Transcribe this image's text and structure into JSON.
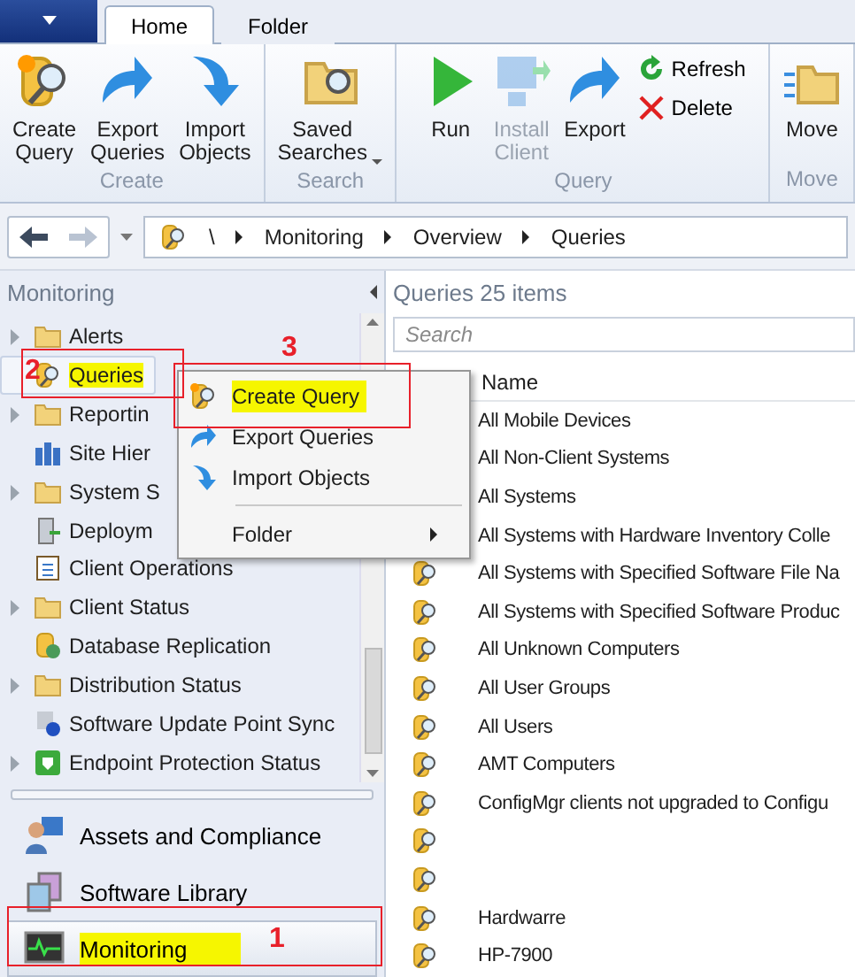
{
  "ribbon": {
    "app_button": {
      "selected": false
    },
    "tabs": [
      {
        "label": "Home",
        "selected": true
      },
      {
        "label": "Folder",
        "selected": false
      }
    ],
    "groups": [
      {
        "label": "Create",
        "buttons": [
          {
            "label": "Create\nQuery",
            "disabled": false
          },
          {
            "label": "Export\nQueries",
            "disabled": false
          },
          {
            "label": "Import\nObjects",
            "disabled": false
          }
        ]
      },
      {
        "label": "Search",
        "buttons": [
          {
            "label": "Saved\nSearches",
            "disabled": false,
            "dropdown": true
          }
        ]
      },
      {
        "label": "Query",
        "buttons": [
          {
            "label": "Run",
            "disabled": false
          },
          {
            "label": "Install\nClient",
            "disabled": true
          },
          {
            "label": "Export",
            "disabled": false
          }
        ],
        "small_buttons": [
          {
            "label": "Refresh"
          },
          {
            "label": "Delete"
          }
        ]
      },
      {
        "label": "Move",
        "buttons": [
          {
            "label": "Move",
            "disabled": false
          }
        ]
      }
    ]
  },
  "nav": {
    "back_disabled": false,
    "forward_disabled": true,
    "breadcrumb": [
      "\\",
      "Monitoring",
      "Overview",
      "Queries"
    ]
  },
  "left_pane": {
    "title": "Monitoring",
    "tree": [
      {
        "label": "Alerts",
        "expandable": true,
        "selected": false,
        "highlighted": false
      },
      {
        "label": "Queries",
        "expandable": false,
        "selected": true,
        "highlighted": true
      },
      {
        "label": "Reportin",
        "expandable": true,
        "selected": false,
        "highlighted": false
      },
      {
        "label": "Site Hier",
        "expandable": false,
        "selected": false,
        "highlighted": false
      },
      {
        "label": "System S",
        "expandable": true,
        "selected": false,
        "highlighted": false
      },
      {
        "label": "Deploym",
        "expandable": false,
        "selected": false,
        "highlighted": false
      },
      {
        "label": "Client Operations",
        "expandable": false,
        "selected": false,
        "highlighted": false
      },
      {
        "label": "Client Status",
        "expandable": true,
        "selected": false,
        "highlighted": false
      },
      {
        "label": "Database Replication",
        "expandable": false,
        "selected": false,
        "highlighted": false
      },
      {
        "label": "Distribution Status",
        "expandable": true,
        "selected": false,
        "highlighted": false
      },
      {
        "label": "Software Update Point Sync",
        "expandable": false,
        "selected": false,
        "highlighted": false
      },
      {
        "label": "Endpoint Protection Status",
        "expandable": true,
        "selected": false,
        "highlighted": false
      }
    ],
    "workspaces": [
      {
        "label": "Assets and Compliance",
        "selected": false,
        "highlighted": false
      },
      {
        "label": "Software Library",
        "selected": false,
        "highlighted": false
      },
      {
        "label": "Monitoring",
        "selected": true,
        "highlighted": true
      }
    ]
  },
  "right_pane": {
    "title": "Queries 25 items",
    "search": {
      "placeholder": "Search"
    },
    "columns": [
      "Name"
    ],
    "rows": [
      {
        "name": "All Mobile Devices"
      },
      {
        "name": "All Non-Client Systems"
      },
      {
        "name": "All Systems"
      },
      {
        "name": "All Systems with Hardware Inventory Colle"
      },
      {
        "name": "All Systems with Specified Software File Na"
      },
      {
        "name": "All Systems with Specified Software Produc"
      },
      {
        "name": "All Unknown Computers"
      },
      {
        "name": "All User Groups"
      },
      {
        "name": "All Users"
      },
      {
        "name": "AMT Computers"
      },
      {
        "name": "ConfigMgr clients not upgraded to Configu"
      },
      {},
      {},
      {
        "name": "Hardwarre"
      },
      {
        "name": "HP-7900"
      }
    ]
  },
  "context_menu": {
    "items": [
      {
        "kind": "item",
        "label": "Create Query",
        "highlighted": true
      },
      {
        "kind": "item",
        "label": "Export Queries",
        "highlighted": false
      },
      {
        "kind": "item",
        "label": "Import Objects",
        "highlighted": false
      },
      {
        "kind": "separator"
      },
      {
        "kind": "submenu",
        "label": "Folder",
        "highlighted": false
      }
    ]
  },
  "annotations": [
    {
      "label": "1"
    },
    {
      "label": "2"
    },
    {
      "label": "3"
    }
  ]
}
